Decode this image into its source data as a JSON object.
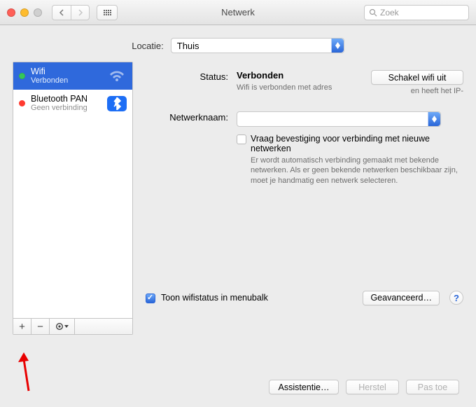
{
  "window": {
    "title": "Netwerk",
    "search_placeholder": "Zoek"
  },
  "location": {
    "label": "Locatie:",
    "value": "Thuis"
  },
  "sidebar": {
    "items": [
      {
        "name": "Wifi",
        "status": "Verbonden",
        "dot": "#35c759",
        "selected": true,
        "icon": "wifi-icon"
      },
      {
        "name": "Bluetooth PAN",
        "status": "Geen verbinding",
        "dot": "#ff3b30",
        "selected": false,
        "icon": "bluetooth-icon"
      }
    ],
    "footer": {
      "add": "+",
      "remove": "−"
    }
  },
  "detail": {
    "status_label": "Status:",
    "status_value": "Verbonden",
    "wifi_off_btn": "Schakel wifi uit",
    "status_help_left": "Wifi is verbonden met adres",
    "status_help_right": "en heeft het IP-",
    "network_name_label": "Netwerknaam:",
    "network_name_value": "",
    "ask_checkbox": "Vraag bevestiging voor verbinding met nieuwe netwerken",
    "ask_help": "Er wordt automatisch verbinding gemaakt met bekende netwerken. Als er geen bekende netwerken beschikbaar zijn, moet je handmatig een netwerk selecteren.",
    "show_status_checkbox": "Toon wifistatus in menubalk",
    "advanced_btn": "Geavanceerd…",
    "help_symbol": "?"
  },
  "footer": {
    "assist": "Assistentie…",
    "revert": "Herstel",
    "apply": "Pas toe"
  }
}
